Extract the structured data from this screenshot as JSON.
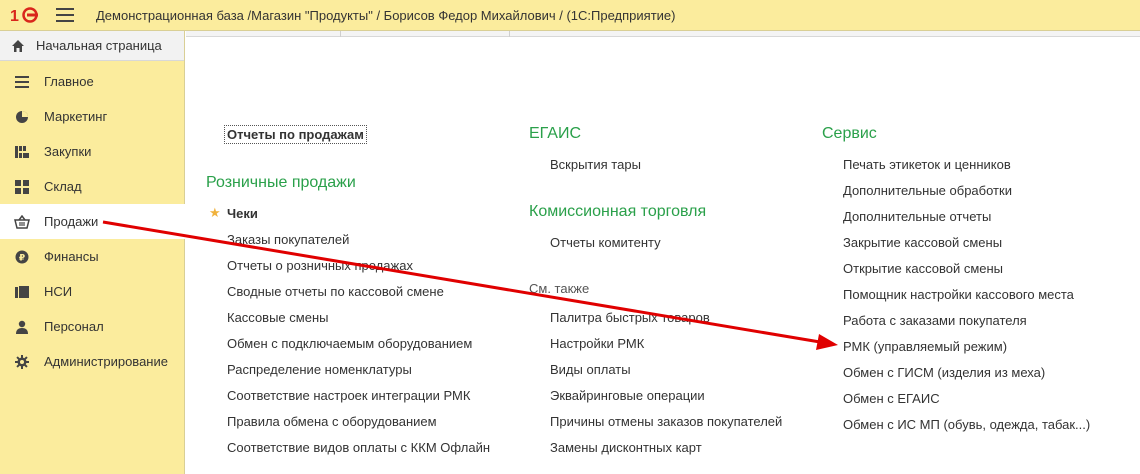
{
  "window": {
    "title": "Демонстрационная база /Магазин \"Продукты\" / Борисов Федор Михайлович /  (1С:Предприятие)"
  },
  "home": {
    "label": "Начальная страница"
  },
  "sidebar": {
    "items": [
      {
        "label": "Главное",
        "icon": "menu-lines-icon"
      },
      {
        "label": "Маркетинг",
        "icon": "pie-chart-icon"
      },
      {
        "label": "Закупки",
        "icon": "purchases-icon"
      },
      {
        "label": "Склад",
        "icon": "warehouse-grid-icon"
      },
      {
        "label": "Продажи",
        "icon": "basket-icon",
        "active": true
      },
      {
        "label": "Финансы",
        "icon": "ruble-coin-icon"
      },
      {
        "label": "НСИ",
        "icon": "catalog-icon"
      },
      {
        "label": "Персонал",
        "icon": "person-icon"
      },
      {
        "label": "Администрирование",
        "icon": "gear-icon"
      }
    ]
  },
  "col1": {
    "top_link": "Отчеты по продажам",
    "group_title": "Розничные продажи",
    "items": [
      "Чеки",
      "Заказы покупателей",
      "Отчеты о розничных продажах",
      "Сводные отчеты по кассовой смене",
      "Кассовые смены",
      "Обмен с подключаемым оборудованием",
      "Распределение номенклатуры",
      "Соответствие настроек интеграции РМК",
      "Правила обмена с оборудованием",
      "Соответствие видов оплаты с ККМ Офлайн"
    ]
  },
  "col2": {
    "group1_title": "ЕГАИС",
    "group1_items": [
      "Вскрытия тары"
    ],
    "group2_title": "Комиссионная торговля",
    "group2_items": [
      "Отчеты комитенту"
    ],
    "see_also_title": "См. также",
    "see_also_items": [
      "Палитра быстрых товаров",
      "Настройки РМК",
      "Виды оплаты",
      "Эквайринговые операции",
      "Причины отмены заказов покупателей",
      "Замены дисконтных карт"
    ]
  },
  "col3": {
    "group_title": "Сервис",
    "items": [
      "Печать этикеток и ценников",
      "Дополнительные обработки",
      "Дополнительные отчеты",
      "Закрытие кассовой смены",
      "Открытие кассовой смены",
      "Помощник настройки кассового места",
      "Работа с заказами покупателя",
      "РМК (управляемый режим)",
      "Обмен с ГИСМ (изделия из меха)",
      "Обмен с ЕГАИС",
      "Обмен с ИС МП (обувь, одежда, табак...)"
    ]
  },
  "colors": {
    "panel": "#fbec9d",
    "group_title": "#2aa04a",
    "arrow": "#e00000",
    "star": "#f0b23c"
  }
}
